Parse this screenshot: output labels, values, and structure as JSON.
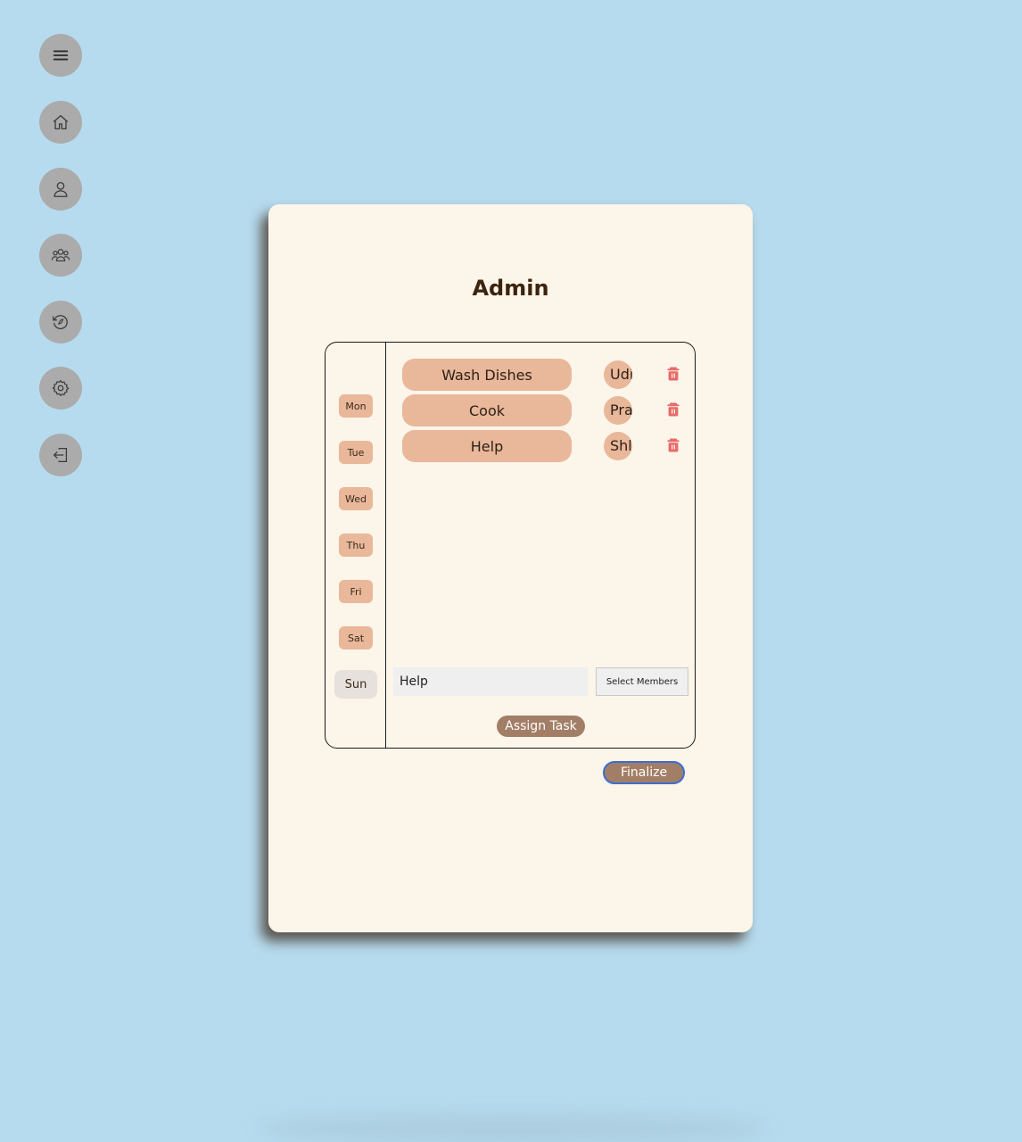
{
  "sidebar": {
    "items": [
      {
        "icon": "menu-icon"
      },
      {
        "icon": "home-icon"
      },
      {
        "icon": "user-icon"
      },
      {
        "icon": "group-icon"
      },
      {
        "icon": "history-icon"
      },
      {
        "icon": "gear-icon"
      },
      {
        "icon": "logout-icon"
      }
    ]
  },
  "card": {
    "title": "Admin"
  },
  "days": [
    "Mon",
    "Tue",
    "Wed",
    "Thu",
    "Fri",
    "Sat",
    "Sun"
  ],
  "selected_day": "Sun",
  "tasks": [
    {
      "name": "Wash Dishes",
      "member": "Udit"
    },
    {
      "name": "Cook",
      "member": "Pranav"
    },
    {
      "name": "Help",
      "member": "Shlok"
    }
  ],
  "form": {
    "task_value": "Help",
    "select_members_label": "Select Members",
    "assign_label": "Assign Task"
  },
  "finalize_label": "Finalize",
  "colors": {
    "background": "#b6dbee",
    "card": "#fcf5ea",
    "pill": "#e9b799",
    "action": "#a27e66",
    "trash": "#e86a6a",
    "sidebar_button": "#ababab"
  }
}
